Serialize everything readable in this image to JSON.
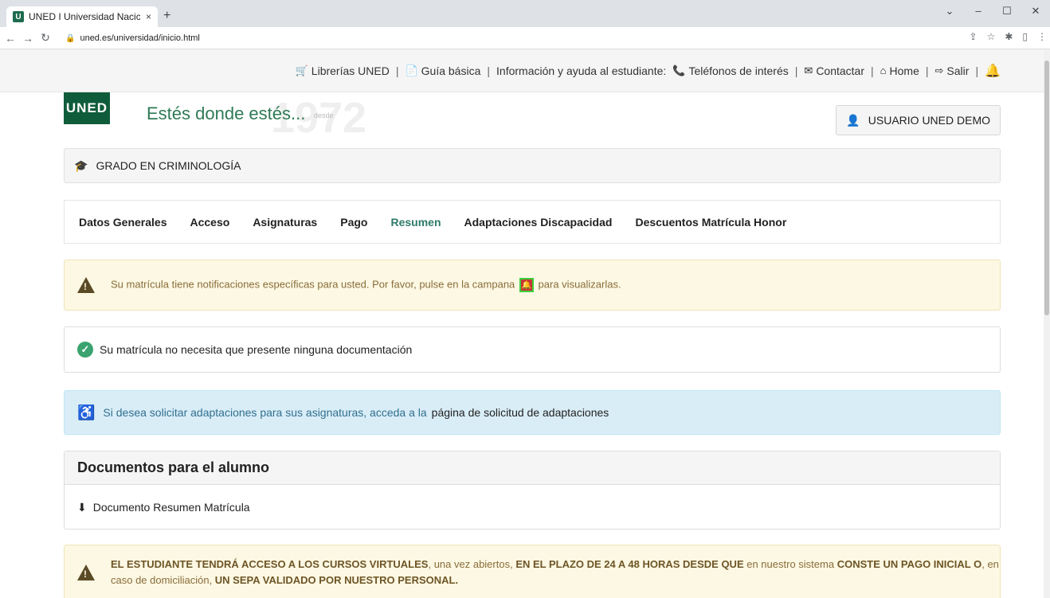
{
  "browser": {
    "tab_title": "UNED I Universidad Nacic",
    "tab_close": "×",
    "new_tab": "+",
    "url": "uned.es/universidad/inicio.html",
    "favicon_letter": "U"
  },
  "topbar": {
    "librerias": "Librerías UNED",
    "guia": "Guía básica",
    "info": "Información y ayuda al estudiante:",
    "telefonos": "Teléfonos de interés",
    "contactar": "Contactar",
    "home": "Home",
    "salir": "Salir"
  },
  "header": {
    "logo": "UNED",
    "slogan": "Estés donde estés...",
    "desde": "desde",
    "watermark_year": "1972",
    "user_button": "USUARIO UNED DEMO"
  },
  "grado": {
    "label": "GRADO EN CRIMINOLOGÍA"
  },
  "nav": {
    "items": [
      "Datos Generales",
      "Acceso",
      "Asignaturas",
      "Pago",
      "Resumen",
      "Adaptaciones Discapacidad",
      "Descuentos Matrícula Honor"
    ]
  },
  "alerts": {
    "notif_pre": "Su matrícula tiene notificaciones específicas para usted. Por favor, pulse en la campana",
    "notif_post": "para visualizarlas.",
    "docs_ok": "Su matrícula no necesita que presente ninguna documentación",
    "adapt_pre": "Si desea solicitar adaptaciones para sus asignaturas, acceda a la",
    "adapt_link": "página de solicitud de adaptaciones"
  },
  "panel": {
    "title": "Documentos para el alumno",
    "doc_link": "Documento Resumen Matrícula"
  },
  "bottom_alert": {
    "b1": "EL ESTUDIANTE TENDRÁ ACCESO A LOS CURSOS VIRTUALES",
    "t1": ", una vez abiertos, ",
    "b2": "EN EL PLAZO DE 24 A 48 HORAS DESDE QUE",
    "t2": " en nuestro sistema ",
    "b3": "CONSTE UN PAGO INICIAL O",
    "t3": ", en caso de domiciliación, ",
    "b4": "UN SEPA VALIDADO POR NUESTRO PERSONAL."
  },
  "colors": {
    "uned_green": "#0f5c3a",
    "active_tab": "#2f7a6a",
    "bell_red": "#e03030"
  }
}
